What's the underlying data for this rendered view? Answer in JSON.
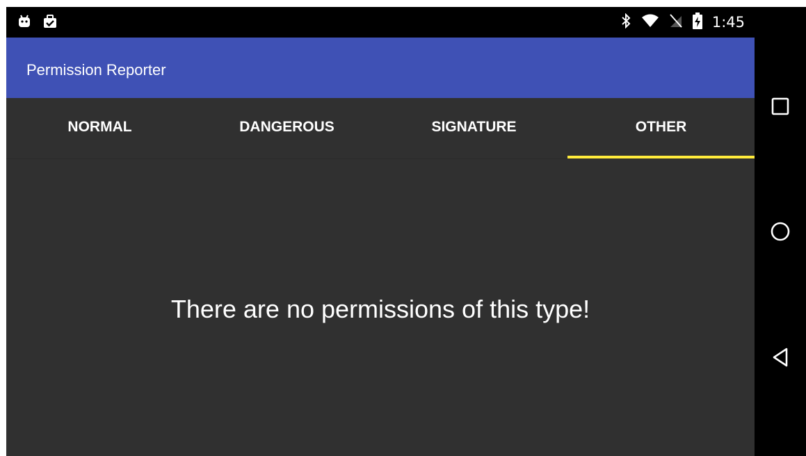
{
  "status_bar": {
    "left_icons": [
      "android-debug-icon",
      "briefcase-check-icon"
    ],
    "right_icons": [
      "bluetooth-icon",
      "wifi-icon",
      "no-sim-icon",
      "battery-charging-icon"
    ],
    "time": "1:45"
  },
  "app_bar": {
    "title": "Permission Reporter",
    "color": "#3f51b5"
  },
  "tabs": [
    {
      "label": "NORMAL",
      "active": false
    },
    {
      "label": "DANGEROUS",
      "active": false
    },
    {
      "label": "SIGNATURE",
      "active": false
    },
    {
      "label": "OTHER",
      "active": true
    }
  ],
  "tab_indicator_color": "#ffeb3b",
  "content": {
    "empty_message": "There are no permissions of this type!"
  },
  "nav_bar": {
    "buttons": [
      "recents-square-icon",
      "home-circle-icon",
      "back-triangle-icon"
    ]
  }
}
